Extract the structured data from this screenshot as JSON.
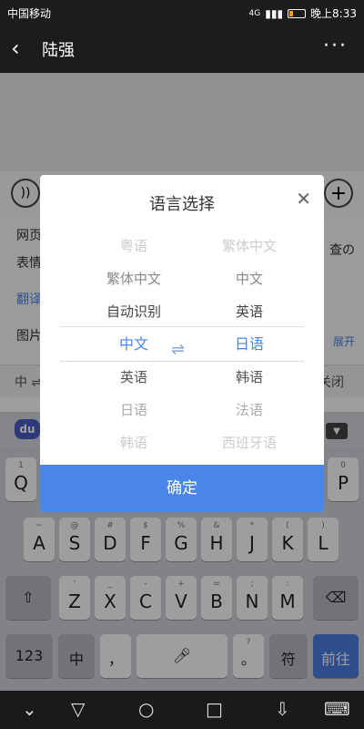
{
  "status_bar": {
    "carrier": "中国移动",
    "signal_label": "4G",
    "time": "晚上8:33"
  },
  "header": {
    "contact_name": "陆强",
    "more_label": "···"
  },
  "panel": {
    "rows": [
      "网页",
      "表情",
      "翻译",
      "图片"
    ],
    "right_fragments": [
      "查の",
      "展开"
    ],
    "bottom_left": "中 ⇌",
    "bottom_right": "关闭"
  },
  "dialog": {
    "title": "语言选择",
    "source_languages": [
      "粤语",
      "繁体中文",
      "自动识别",
      "中文",
      "英语",
      "日语",
      "韩语"
    ],
    "target_languages": [
      "繁体中文",
      "中文",
      "英语",
      "日语",
      "韩语",
      "法语",
      "西班牙语"
    ],
    "selected_source": "中文",
    "selected_target": "日语",
    "confirm_label": "确定"
  },
  "keyboard": {
    "logo": "du",
    "row1": [
      {
        "main": "Q",
        "sub": "1"
      },
      {
        "main": "P",
        "sub": "0"
      }
    ],
    "row2": [
      {
        "main": "A",
        "sub": "~"
      },
      {
        "main": "S",
        "sub": "@"
      },
      {
        "main": "D",
        "sub": "#"
      },
      {
        "main": "F",
        "sub": "$"
      },
      {
        "main": "G",
        "sub": "%"
      },
      {
        "main": "H",
        "sub": "&"
      },
      {
        "main": "J",
        "sub": "*"
      },
      {
        "main": "K",
        "sub": "("
      },
      {
        "main": "L",
        "sub": ")"
      }
    ],
    "row3": [
      {
        "main": "Z",
        "sub": "'"
      },
      {
        "main": "X",
        "sub": "_"
      },
      {
        "main": "C",
        "sub": "-"
      },
      {
        "main": "V",
        "sub": "+"
      },
      {
        "main": "B",
        "sub": "="
      },
      {
        "main": "N",
        "sub": ";"
      },
      {
        "main": "M",
        "sub": ":"
      }
    ],
    "num_key": "123",
    "lang_key": "中",
    "comma_key": "，",
    "period_key": "。",
    "symbol_key": "符",
    "go_key": "前往",
    "qmark_sub": "?"
  },
  "colors": {
    "accent": "#4a86e8",
    "selected_text": "#4a86e8"
  }
}
